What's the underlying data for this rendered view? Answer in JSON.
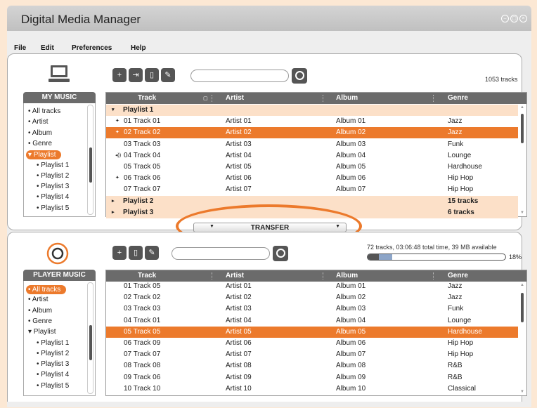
{
  "app": {
    "title": "Digital Media Manager"
  },
  "window_buttons": [
    "–",
    "▢",
    "×"
  ],
  "menu": [
    "File",
    "Edit",
    "Preferences",
    "Help"
  ],
  "my_music": {
    "track_count": "1053 tracks",
    "sidebar_title": "MY MUSIC",
    "sidebar": [
      {
        "label": "• All tracks",
        "sub": false,
        "selected": false
      },
      {
        "label": "• Artist",
        "sub": false,
        "selected": false
      },
      {
        "label": "• Album",
        "sub": false,
        "selected": false
      },
      {
        "label": "• Genre",
        "sub": false,
        "selected": false
      },
      {
        "label": "▾ Playlist",
        "sub": false,
        "selected": true
      },
      {
        "label": "• Playlist 1",
        "sub": true,
        "selected": false
      },
      {
        "label": "• Playlist 2",
        "sub": true,
        "selected": false
      },
      {
        "label": "• Playlist 3",
        "sub": true,
        "selected": false
      },
      {
        "label": "• Playlist 4",
        "sub": true,
        "selected": false
      },
      {
        "label": "• Playlist 5",
        "sub": true,
        "selected": false
      }
    ],
    "columns": [
      "Track",
      "Artist",
      "Album",
      "Genre"
    ],
    "rows": [
      {
        "type": "group",
        "marker": "▾",
        "track": "Playlist 1",
        "artist": "",
        "album": "",
        "genre": ""
      },
      {
        "type": "row",
        "marker": "✦",
        "track": "01  Track 01",
        "artist": "Artist 01",
        "album": "Album 01",
        "genre": "Jazz"
      },
      {
        "type": "sel",
        "marker": "✦",
        "track": "02  Track 02",
        "artist": "Artist 02",
        "album": "Album 02",
        "genre": "Jazz"
      },
      {
        "type": "row",
        "marker": "",
        "track": "03  Track 03",
        "artist": "Artist 03",
        "album": "Album 03",
        "genre": "Funk"
      },
      {
        "type": "row",
        "marker": "◂))",
        "track": "04  Track 04",
        "artist": "Artist 04",
        "album": "Album 04",
        "genre": "Lounge"
      },
      {
        "type": "row",
        "marker": "",
        "track": "05  Track 05",
        "artist": "Artist 05",
        "album": "Album 05",
        "genre": "Hardhouse"
      },
      {
        "type": "row",
        "marker": "✦",
        "track": "06  Track 06",
        "artist": "Artist 06",
        "album": "Album 06",
        "genre": "Hip Hop"
      },
      {
        "type": "row",
        "marker": "",
        "track": "07  Track 07",
        "artist": "Artist 07",
        "album": "Album 07",
        "genre": "Hip Hop"
      },
      {
        "type": "group",
        "marker": "▸",
        "track": "Playlist 2",
        "artist": "",
        "album": "",
        "genre": "15 tracks"
      },
      {
        "type": "group",
        "marker": "▸",
        "track": "Playlist 3",
        "artist": "",
        "album": "",
        "genre": "6 tracks"
      }
    ]
  },
  "transfer": {
    "label": "TRANSFER",
    "arrow": "▼"
  },
  "player_music": {
    "status": "72 tracks, 03:06:48 total time, 39 MB available",
    "storage_used_percent": 18,
    "storage_label": "18%",
    "sidebar_title": "PLAYER MUSIC",
    "sidebar": [
      {
        "label": "• All tracks",
        "sub": false,
        "selected": true
      },
      {
        "label": "• Artist",
        "sub": false,
        "selected": false
      },
      {
        "label": "• Album",
        "sub": false,
        "selected": false
      },
      {
        "label": "• Genre",
        "sub": false,
        "selected": false
      },
      {
        "label": "▾ Playlist",
        "sub": false,
        "selected": false
      },
      {
        "label": "• Playlist 1",
        "sub": true,
        "selected": false
      },
      {
        "label": "• Playlist 2",
        "sub": true,
        "selected": false
      },
      {
        "label": "• Playlist 3",
        "sub": true,
        "selected": false
      },
      {
        "label": "• Playlist 4",
        "sub": true,
        "selected": false
      },
      {
        "label": "• Playlist 5",
        "sub": true,
        "selected": false
      }
    ],
    "columns": [
      "Track",
      "Artist",
      "Album",
      "Genre"
    ],
    "rows": [
      {
        "type": "row",
        "marker": "",
        "track": "01  Track 05",
        "artist": "Artist 01",
        "album": "Album 01",
        "genre": "Jazz"
      },
      {
        "type": "row",
        "marker": "",
        "track": "02  Track 02",
        "artist": "Artist 02",
        "album": "Album 02",
        "genre": "Jazz"
      },
      {
        "type": "row",
        "marker": "",
        "track": "03  Track 03",
        "artist": "Artist 03",
        "album": "Album 03",
        "genre": "Funk"
      },
      {
        "type": "row",
        "marker": "",
        "track": "04  Track 01",
        "artist": "Artist 04",
        "album": "Album 04",
        "genre": "Lounge"
      },
      {
        "type": "sel",
        "marker": "",
        "track": "05  Track 05",
        "artist": "Artist 05",
        "album": "Album 05",
        "genre": "Hardhouse"
      },
      {
        "type": "row",
        "marker": "",
        "track": "06  Track 09",
        "artist": "Artist 06",
        "album": "Album 06",
        "genre": "Hip Hop"
      },
      {
        "type": "row",
        "marker": "",
        "track": "07  Track 07",
        "artist": "Artist 07",
        "album": "Album 07",
        "genre": "Hip Hop"
      },
      {
        "type": "row",
        "marker": "",
        "track": "08  Track 08",
        "artist": "Artist 08",
        "album": "Album 08",
        "genre": "R&B"
      },
      {
        "type": "row",
        "marker": "",
        "track": "09  Track 06",
        "artist": "Artist 09",
        "album": "Album 09",
        "genre": "R&B"
      },
      {
        "type": "row",
        "marker": "",
        "track": "10  Track 10",
        "artist": "Artist 10",
        "album": "Album 10",
        "genre": "Classical"
      }
    ]
  },
  "colors": {
    "accent": "#ec7a2c",
    "header": "#6b6b6b",
    "group_row": "#fce0c8",
    "storage_bar": "#8da5c8"
  }
}
